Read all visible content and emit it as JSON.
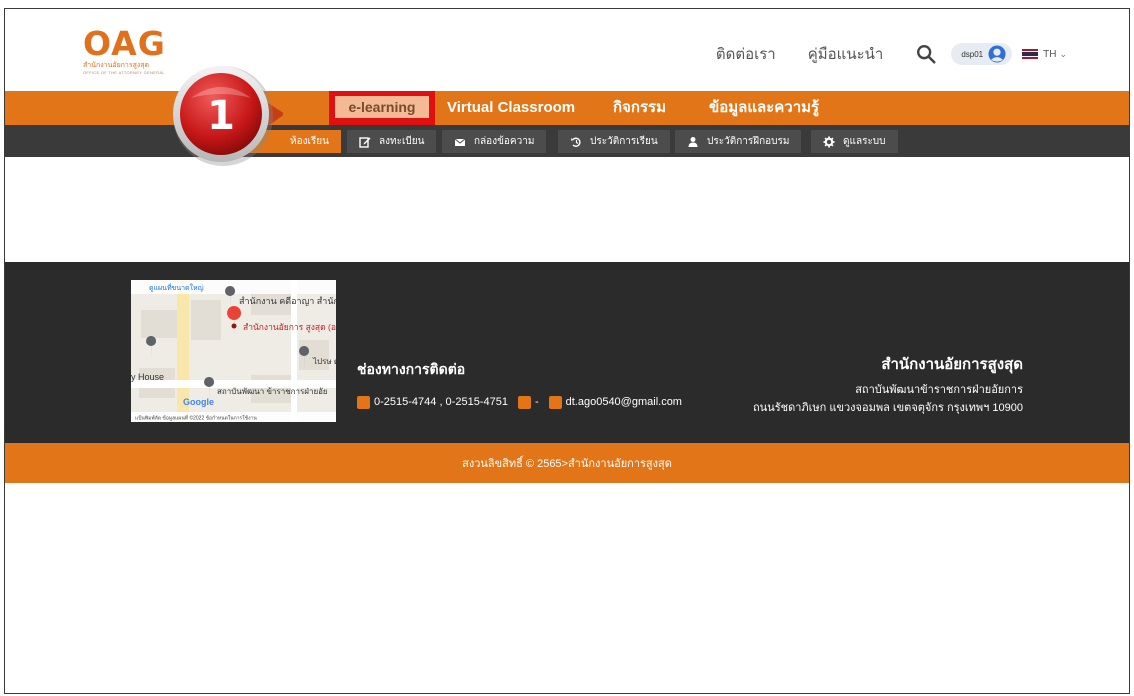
{
  "header": {
    "logo_mark": "OAG",
    "logo_sub": "สำนักงานอัยการสูงสุด",
    "logo_sub2": "OFFICE OF THE ATTORNEY GENERAL",
    "contact_link": "ติดต่อเรา",
    "manual_link": "คู่มือแนะนำ",
    "user_name": "dsp01",
    "language": "TH"
  },
  "annotation": {
    "step_number": "1"
  },
  "main_nav": [
    {
      "label": "e-learning"
    },
    {
      "label": "Virtual Classroom"
    },
    {
      "label": "กิจกรรม"
    },
    {
      "label": "ข้อมูลและความรู้"
    }
  ],
  "sub_nav": [
    {
      "label": "ห้องเรียน"
    },
    {
      "label": "ลงทะเบียน"
    },
    {
      "label": "กล่องข้อความ"
    },
    {
      "label": "ประวัติการเรียน"
    },
    {
      "label": "ประวัติการฝึกอบรม"
    },
    {
      "label": "ดูแลระบบ"
    }
  ],
  "map": {
    "label_enlarge": "ดูแผนที่ขนาดใหญ่",
    "place1": "สำนักงาน คดีอาญา สำนักงาน...",
    "place2": "สำนักงานอัยการ สูงสุด (อาคาร ถนน...",
    "place3": "ไปรษ ดาข",
    "place4": "y House",
    "place5": "สถาบันพัฒนา ข้าราชการฝ่ายอัย",
    "google": "Google",
    "footer_text": "แป้นพิมพ์ลัด   ข้อมูลแผนที่ ©2022   ข้อกำหนดในการใช้งาน"
  },
  "footer": {
    "contact_title": "ช่องทางการติดต่อ",
    "phone": "0-2515-4744 , 0-2515-4751",
    "fax": "-",
    "email": "dt.ago0540@gmail.com",
    "org_title": "สำนักงานอัยการสูงสุด",
    "org_line1": "สถาบันพัฒนาข้าราชการฝ่ายอัยการ",
    "org_line2": "ถนนรัชดาภิเษก แขวงจอมพล เขตจตุจักร กรุงเทพฯ 10900"
  },
  "copyright": "สงวนลิขสิทธิ์ © 2565>สำนักงานอัยการสูงสุด",
  "colors": {
    "orange": "#e27518",
    "dark": "#2b2b2b",
    "highlight": "#e01010"
  }
}
